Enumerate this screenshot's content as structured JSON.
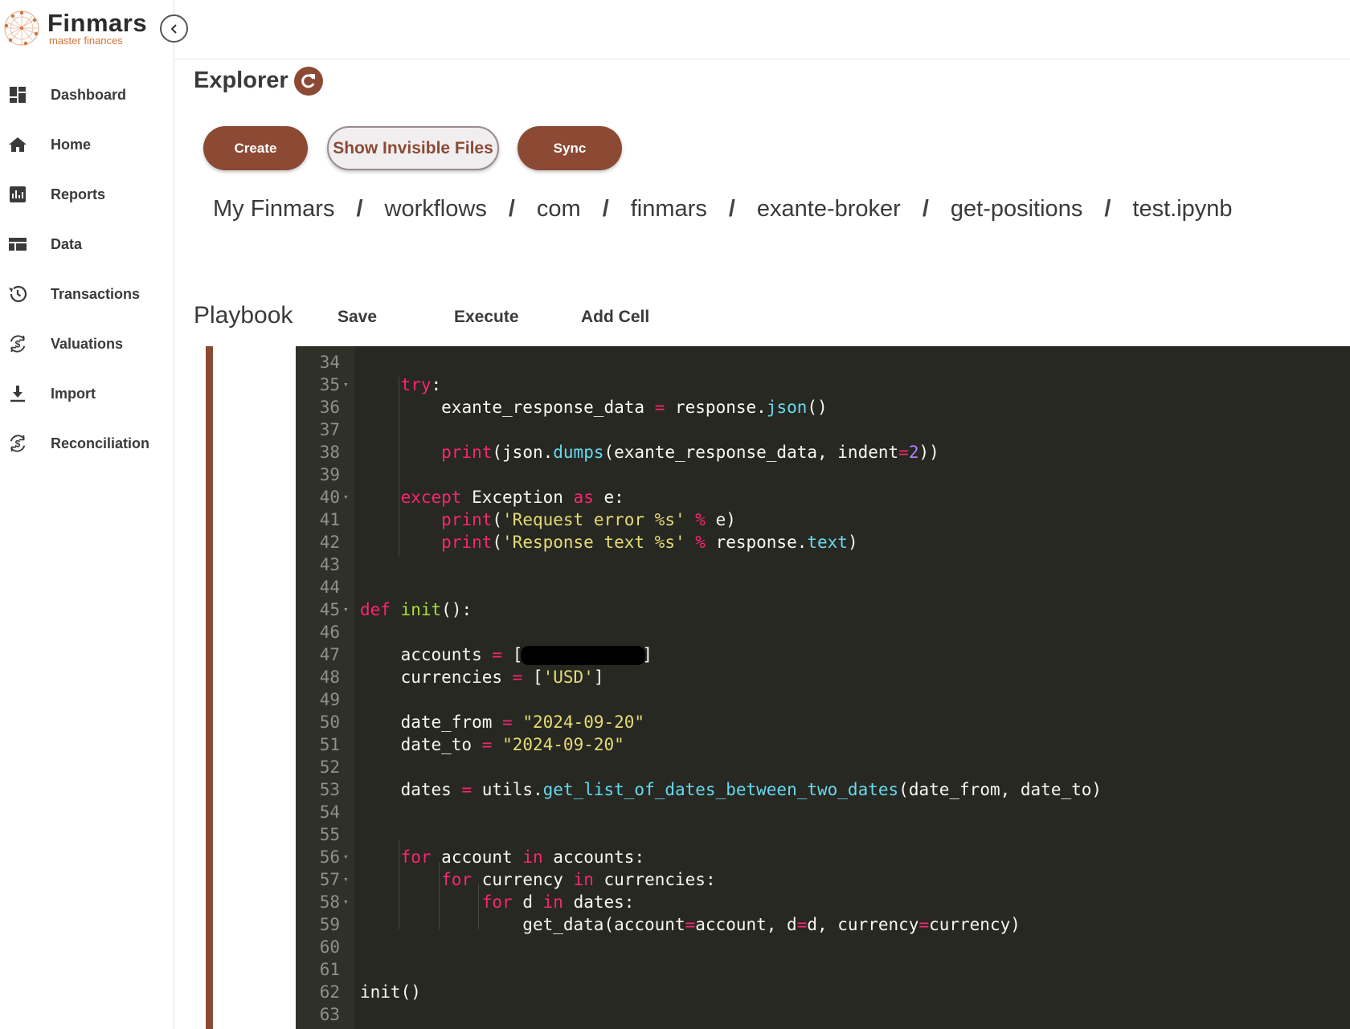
{
  "brand": {
    "name": "Finmars",
    "tagline": "master finances"
  },
  "sidebar": {
    "items": [
      {
        "label": "Dashboard",
        "icon": "dashboard-icon"
      },
      {
        "label": "Home",
        "icon": "home-icon"
      },
      {
        "label": "Reports",
        "icon": "reports-icon"
      },
      {
        "label": "Data",
        "icon": "data-icon"
      },
      {
        "label": "Transactions",
        "icon": "history-icon"
      },
      {
        "label": "Valuations",
        "icon": "currency-sync-icon"
      },
      {
        "label": "Import",
        "icon": "download-icon"
      },
      {
        "label": "Reconciliation",
        "icon": "currency-sync-icon"
      }
    ]
  },
  "page": {
    "title": "Explorer"
  },
  "actions": {
    "create": "Create",
    "show_invisible": "Show Invisible Files",
    "sync": "Sync"
  },
  "breadcrumb": [
    "My Finmars",
    "workflows",
    "com",
    "finmars",
    "exante-broker",
    "get-positions",
    "test.ipynb"
  ],
  "breadcrumb_separator": "/",
  "playbook": {
    "title": "Playbook",
    "save": "Save",
    "execute": "Execute",
    "add_cell": "Add Cell"
  },
  "editor": {
    "line_numbers": [
      "34",
      "35",
      "36",
      "37",
      "38",
      "39",
      "40",
      "41",
      "42",
      "43",
      "44",
      "45",
      "46",
      "47",
      "48",
      "49",
      "50",
      "51",
      "52",
      "53",
      "54",
      "55",
      "56",
      "57",
      "58",
      "59",
      "60",
      "61",
      "62",
      "63"
    ],
    "code": {
      "l36_var": "exante_response_data",
      "l36_obj": "response",
      "l36_method": "json",
      "l38_call": "print",
      "l38_mod": "json",
      "l38_method": "dumps",
      "l38_args": "exante_response_data, indent",
      "l38_num": "2",
      "l40_kw": "except",
      "l40_exc": "Exception",
      "l40_as": "as",
      "l40_var": "e:",
      "l41_str": "'Request error %s'",
      "l42_str": "'Response text %s'",
      "l42_attr": "text",
      "l45_def": "def",
      "l45_name": "init",
      "l47_var": "accounts",
      "l48_var": "currencies",
      "l48_str": "'USD'",
      "l50_var": "date_from",
      "l50_str": "\"2024-09-20\"",
      "l51_var": "date_to",
      "l51_str": "\"2024-09-20\"",
      "l53_var": "dates",
      "l53_mod": "utils",
      "l53_fn": "get_list_of_dates_between_two_dates",
      "l53_args": "date_from, date_to",
      "l56_iter": "account",
      "l56_src": "accounts:",
      "l57_iter": "currency",
      "l57_src": "currencies:",
      "l58_iter": "d",
      "l58_src": "dates:",
      "l59_fn": "get_data",
      "l62_call": "init()"
    }
  },
  "colors": {
    "accent": "#8c4a35",
    "editor_bg": "#272822",
    "brand_tag": "#d0743b"
  }
}
